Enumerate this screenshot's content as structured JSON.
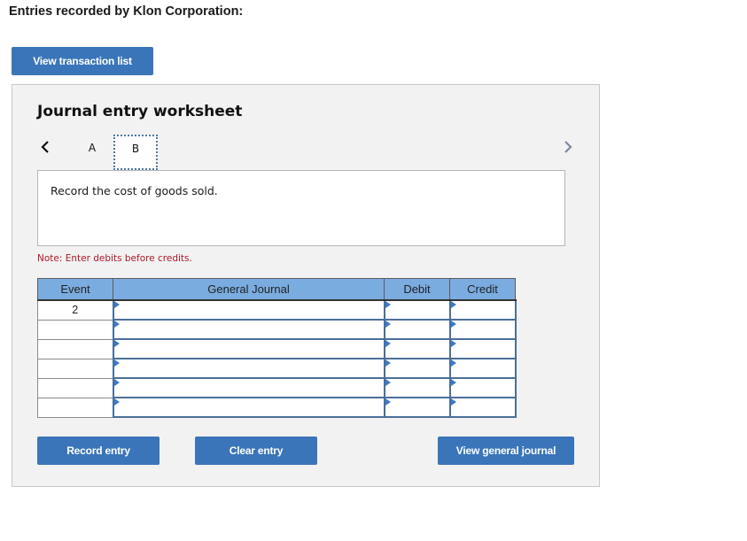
{
  "header": {
    "title": "Entries recorded by Klon Corporation:",
    "view_transactions_label": "View transaction list"
  },
  "worksheet": {
    "title": "Journal entry worksheet",
    "nav": {
      "prev_icon": "chevron-left-icon",
      "next_icon": "chevron-right-icon"
    },
    "tabs": [
      {
        "label": "A",
        "active": false
      },
      {
        "label": "B",
        "active": true
      }
    ],
    "prompt": "Record the cost of goods sold.",
    "note": "Note: Enter debits before credits.",
    "table": {
      "columns": [
        "Event",
        "General Journal",
        "Debit",
        "Credit"
      ],
      "rows": [
        {
          "event": "2",
          "account": "",
          "debit": "",
          "credit": ""
        },
        {
          "event": "",
          "account": "",
          "debit": "",
          "credit": ""
        },
        {
          "event": "",
          "account": "",
          "debit": "",
          "credit": ""
        },
        {
          "event": "",
          "account": "",
          "debit": "",
          "credit": ""
        },
        {
          "event": "",
          "account": "",
          "debit": "",
          "credit": ""
        },
        {
          "event": "",
          "account": "",
          "debit": "",
          "credit": ""
        }
      ]
    },
    "buttons": {
      "record": "Record entry",
      "clear": "Clear entry",
      "view_journal": "View general journal"
    }
  },
  "colors": {
    "button_primary": "#3a75b9",
    "table_header": "#7aace0",
    "note_text": "#b0182a",
    "panel_background": "#f2f2f2"
  }
}
